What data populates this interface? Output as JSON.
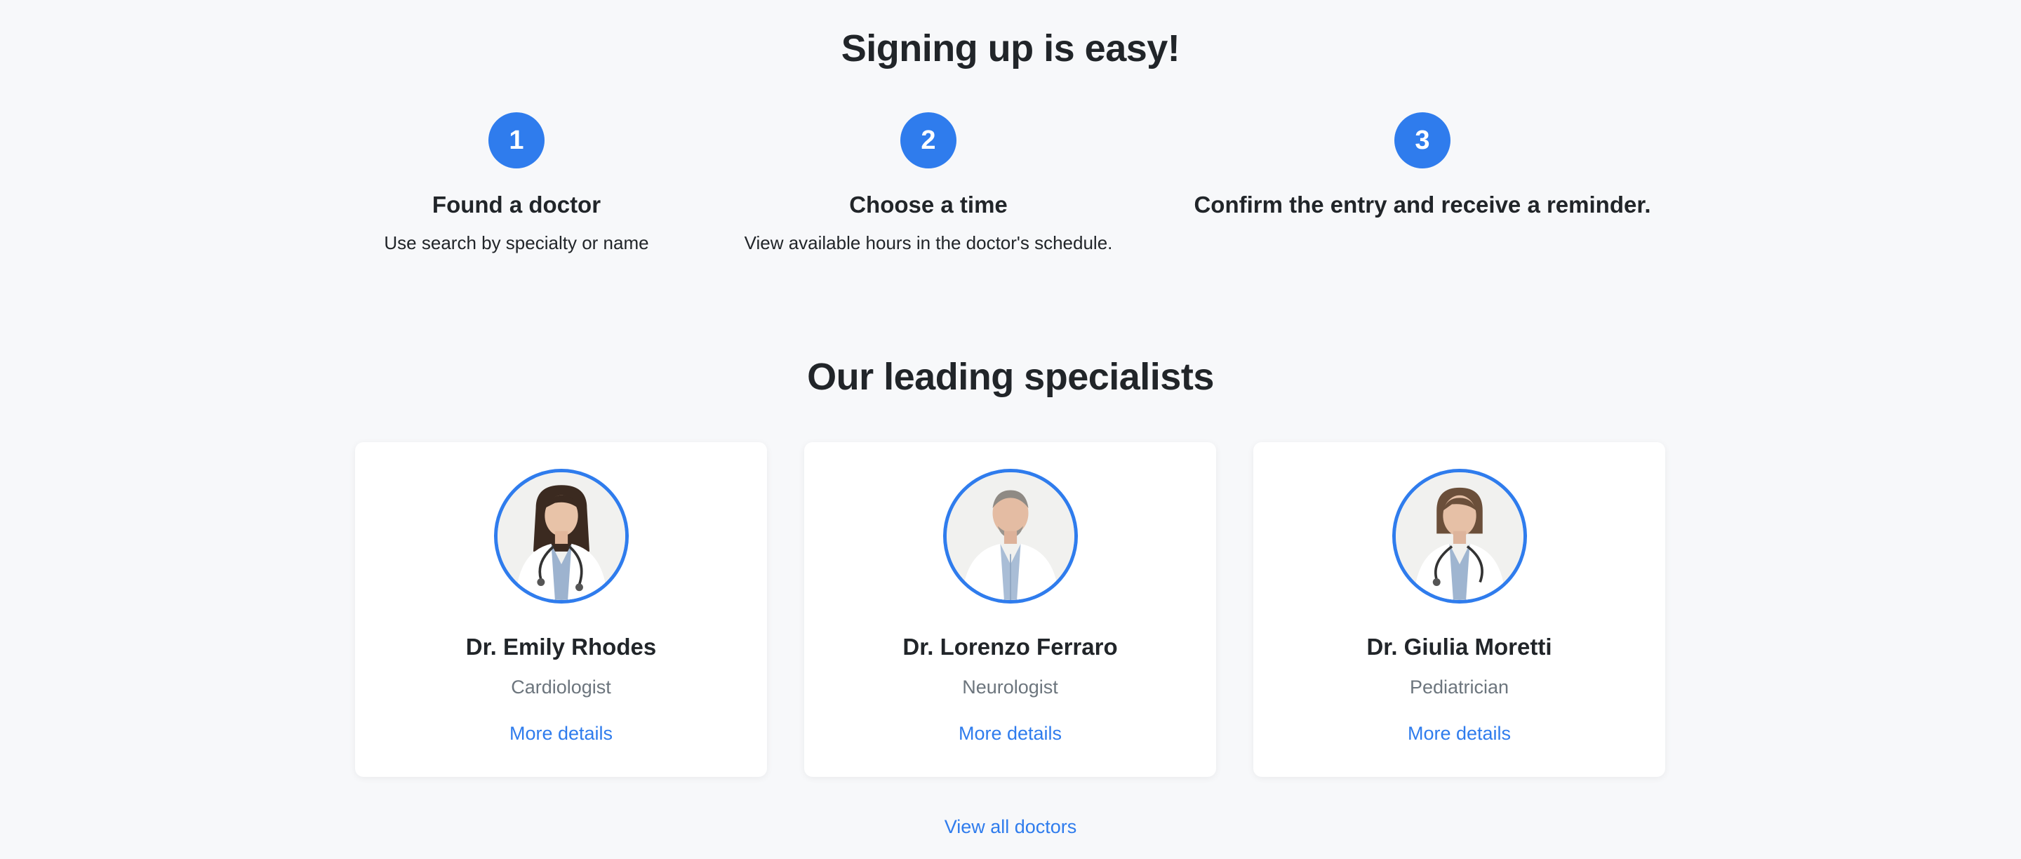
{
  "steps_section": {
    "title": "Signing up is easy!",
    "steps": [
      {
        "number": "1",
        "title": "Found a doctor",
        "description": "Use search by specialty or name"
      },
      {
        "number": "2",
        "title": "Choose a time",
        "description": "View available hours in the doctor's schedule."
      },
      {
        "number": "3",
        "title": "Confirm the entry and receive a reminder.",
        "description": ""
      }
    ]
  },
  "specialists_section": {
    "title": "Our leading specialists",
    "doctors": [
      {
        "name": "Dr. Emily Rhodes",
        "specialty": "Cardiologist",
        "link_label": "More details"
      },
      {
        "name": "Dr. Lorenzo Ferraro",
        "specialty": "Neurologist",
        "link_label": "More details"
      },
      {
        "name": "Dr. Giulia Moretti",
        "specialty": "Pediatrician",
        "link_label": "More details"
      }
    ],
    "view_all_label": "View all doctors"
  },
  "colors": {
    "accent": "#2f7ced",
    "background": "#f7f8fa",
    "card": "#ffffff",
    "muted_text": "#6c757d",
    "heading_text": "#212529"
  }
}
